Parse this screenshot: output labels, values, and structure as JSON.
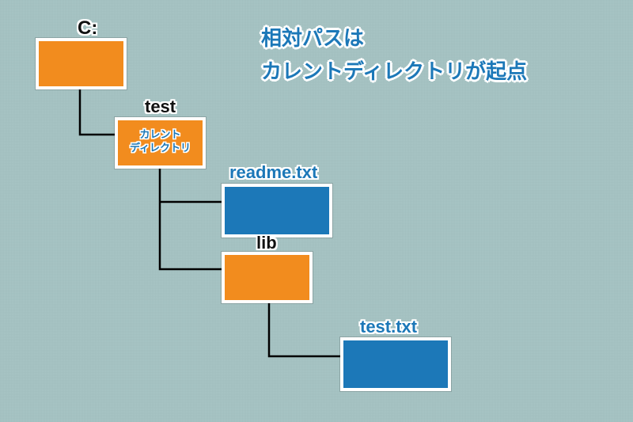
{
  "title": {
    "line1": "相対パスは",
    "line2": "カレントディレクトリが起点"
  },
  "nodes": {
    "c_drive": {
      "label": "C:",
      "type": "folder"
    },
    "test": {
      "label": "test",
      "type": "folder",
      "sub1": "カレント",
      "sub2": "ディレクトリ"
    },
    "readme": {
      "label": "readme.txt",
      "type": "file"
    },
    "lib": {
      "label": "lib",
      "type": "folder"
    },
    "test_txt": {
      "label": "test.txt",
      "type": "file"
    }
  },
  "colors": {
    "folder": "#f28c1e",
    "file": "#1c78b8",
    "background": "#a8c5c5"
  }
}
